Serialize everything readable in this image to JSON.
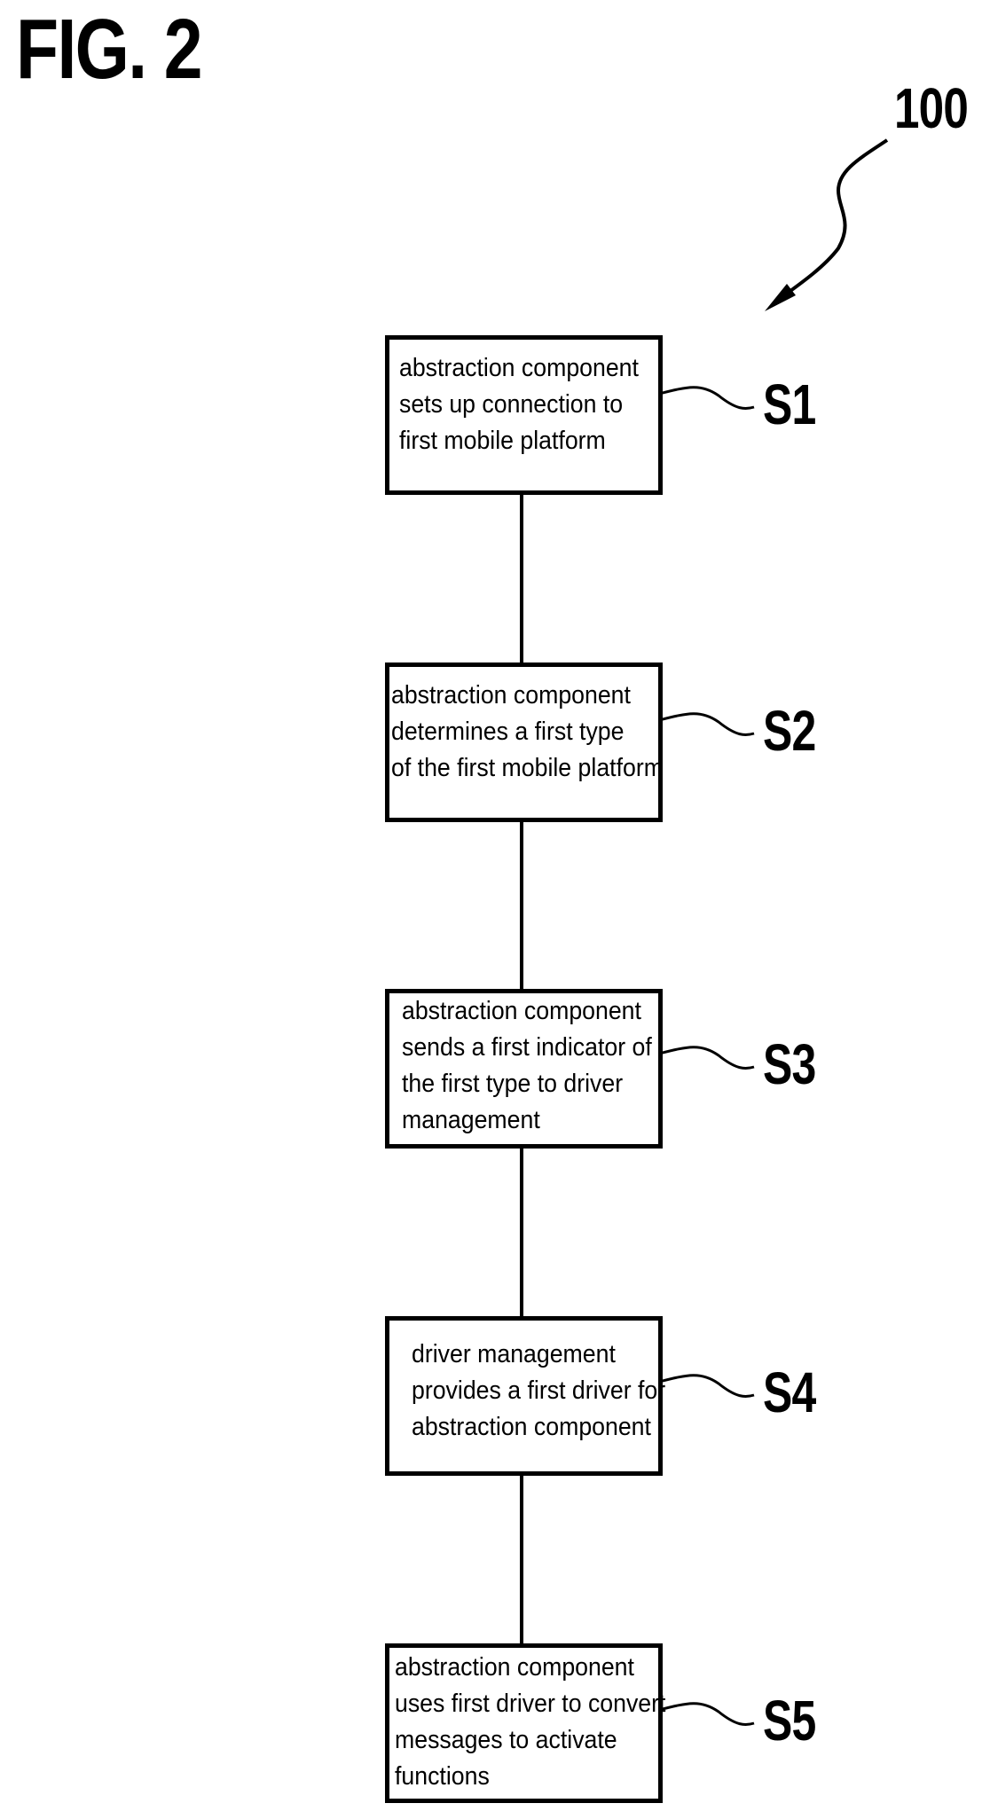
{
  "figure": {
    "title": "FIG. 2",
    "reference_numeral": "100"
  },
  "steps": [
    {
      "id": "S1",
      "label": "S1",
      "text": "abstraction component\nsets up connection to\nfirst mobile platform"
    },
    {
      "id": "S2",
      "label": "S2",
      "text": "abstraction component\ndetermines a first type\nof the first mobile platform"
    },
    {
      "id": "S3",
      "label": "S3",
      "text": "abstraction component\nsends a first indicator of\nthe first type to driver\nmanagement"
    },
    {
      "id": "S4",
      "label": "S4",
      "text": "driver management\nprovides a first driver for\nabstraction component"
    },
    {
      "id": "S5",
      "label": "S5",
      "text": "abstraction component\nuses first driver to convert\nmessages to activate\nfunctions"
    }
  ],
  "colors": {
    "stroke": "#000000",
    "background": "#ffffff"
  }
}
